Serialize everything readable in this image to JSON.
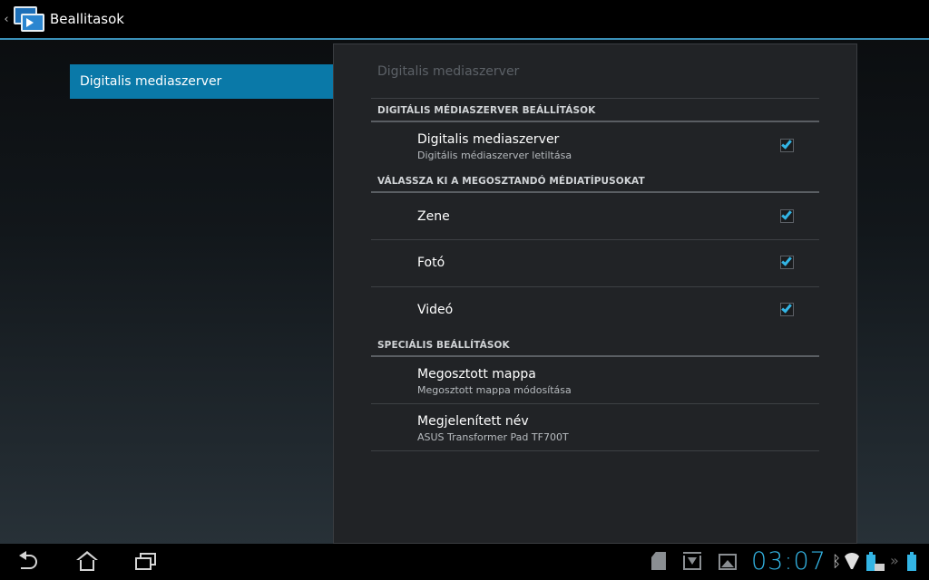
{
  "action_bar": {
    "title": "Beallitasok",
    "app_icon": "media-server-icon",
    "up_icon": "chevron-left-icon"
  },
  "left_pane": {
    "items": [
      {
        "label": "Digitalis mediaszerver",
        "selected": true
      }
    ]
  },
  "panel": {
    "breadcrumb": "Digitalis mediaszerver",
    "sections": [
      {
        "header": "DIGITÁLIS MÉDIASZERVER BEÁLLÍTÁSOK",
        "items": [
          {
            "title": "Digitalis mediaszerver",
            "summary": "Digitális médiaszerver letiltása",
            "checked": true
          }
        ]
      },
      {
        "header": "VÁLASSZA KI A MEGOSZTANDÓ MÉDIATÍPUSOKAT",
        "items": [
          {
            "title": "Zene",
            "checked": true
          },
          {
            "title": "Fotó",
            "checked": true
          },
          {
            "title": "Videó",
            "checked": true
          }
        ]
      },
      {
        "header": "SPECIÁLIS BEÁLLÍTÁSOK",
        "items": [
          {
            "title": "Megosztott mappa",
            "summary": "Megosztott mappa módosítása"
          },
          {
            "title": "Megjelenített név",
            "summary": "ASUS Transformer Pad TF700T"
          }
        ]
      }
    ]
  },
  "system_bar": {
    "clock": "03:07",
    "accent_color": "#33b5e5",
    "nav_icons": [
      "back-icon",
      "home-icon",
      "recent-apps-icon"
    ],
    "status_icons": [
      "sd-card-icon",
      "download-icon",
      "image-icon",
      "bluetooth-icon",
      "wifi-icon",
      "battery-icon",
      "keyboard-dock-icon",
      "more-icon",
      "dock-battery-icon"
    ]
  }
}
